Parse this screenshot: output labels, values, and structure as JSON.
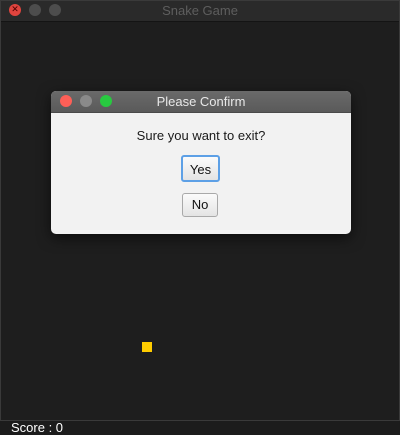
{
  "window": {
    "title": "Snake Game"
  },
  "game": {
    "score_text": "Score : 0",
    "food_color": "#ffcc00"
  },
  "dialog": {
    "title": "Please Confirm",
    "message": "Sure you want to exit?",
    "yes_label": "Yes",
    "no_label": "No"
  },
  "colors": {
    "close_button": "#e0443e",
    "dialog_close": "#fe5f57",
    "dialog_maximize": "#28c940",
    "focus_ring": "#5da0e6"
  }
}
